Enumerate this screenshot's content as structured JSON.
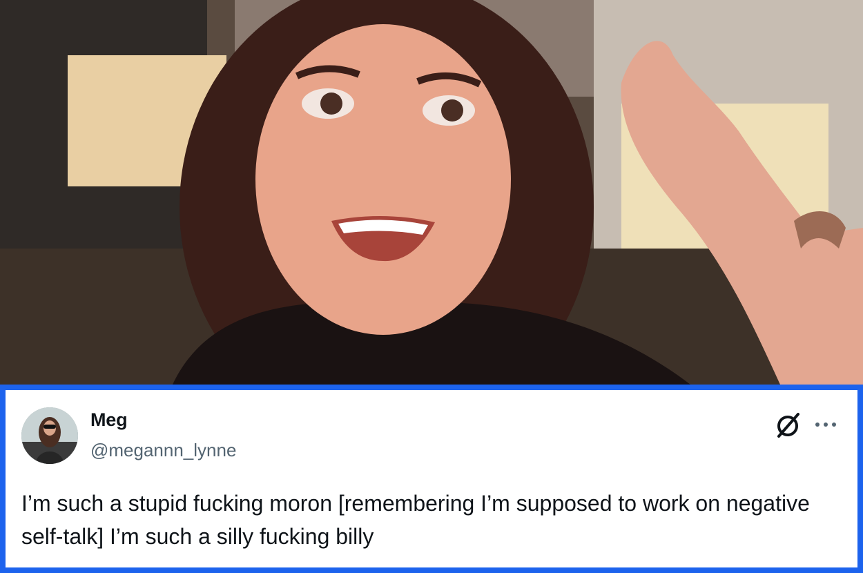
{
  "image": {
    "description_label": "photo-still"
  },
  "tweet": {
    "display_name": "Meg",
    "handle": "@megannn_lynne",
    "text": "I’m such a stupid fucking moron [remembering I’m supposed to work on negative self-talk] I’m such a silly fucking billy",
    "brand_icon": "x-logo-icon",
    "more_icon": "more-dots-icon"
  },
  "colors": {
    "border": "#1d63ed",
    "text": "#0f1419",
    "muted": "#536471"
  }
}
